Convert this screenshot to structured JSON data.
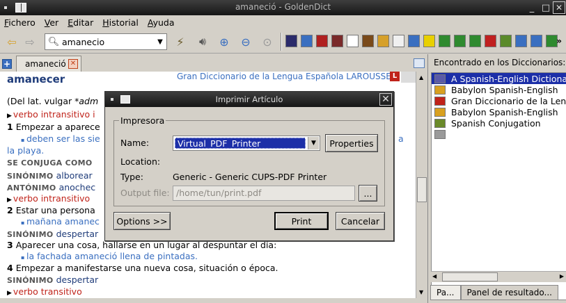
{
  "window": {
    "title": "amaneció - GoldenDict"
  },
  "menu": [
    "Fichero",
    "Ver",
    "Editar",
    "Historial",
    "Ayuda"
  ],
  "toolbar": {
    "search_value": "amanecio",
    "more": "»",
    "dict_icon_colors": [
      "#2b2b6b",
      "#3a6fc0",
      "#b02020",
      "#7a2a2a",
      "#fff",
      "#7a4a1a",
      "#d6a02a",
      "#f0f0f0",
      "#3a6fc0",
      "#e8d000",
      "#2f8a2f",
      "#2f8a2f",
      "#2f8a2f",
      "#c02020",
      "#5a8a2a",
      "#3a6fc0",
      "#3a6fc0",
      "#2f8a2f"
    ]
  },
  "tab": {
    "label": "amaneció"
  },
  "article": {
    "headword": "amanecer",
    "source": "Gran Diccionario de la Lengua Española LAROUSSE",
    "source_badge": "L",
    "lines": [
      {
        "t": "(Del lat. vulgar ",
        "i": "*adm"
      },
      {
        "red": "verbo intransitivo i"
      },
      {
        "num": "1",
        "t": "Empezar a aparece"
      },
      {
        "ex": "deben ser las sie",
        "ex2": "a"
      },
      {
        "blue": "la playa."
      },
      {
        "gray": "SE CONJUGA COMO"
      },
      {
        "gray": "SINÓNIMO",
        "navy": "alborear"
      },
      {
        "gray": "ANTÓNIMO",
        "navy": "anochec"
      },
      {
        "red": "verbo intransitivo"
      },
      {
        "num": "2",
        "t": "Estar una persona"
      },
      {
        "ex": "mañana amanec"
      },
      {
        "gray": "SINÓNIMO",
        "navy": "despertar"
      },
      {
        "num": "3",
        "t": "Aparecer una cosa, hallarse en un lugar al despuntar el día:"
      },
      {
        "ex": "la fachada amaneció llena de pintadas."
      },
      {
        "num": "4",
        "t": "Empezar a manifestarse una nueva cosa, situación o época."
      },
      {
        "gray": "SINÓNIMO",
        "navy": "despertar"
      },
      {
        "red": "verbo transitivo"
      }
    ]
  },
  "right": {
    "title": "Encontrado en los Diccionarios:",
    "items": [
      {
        "label": "A Spanish-English Dictionar",
        "color": "#5a5aa8"
      },
      {
        "label": "Babylon Spanish-English",
        "color": "#d8a020"
      },
      {
        "label": "Gran Diccionario de la Leng",
        "color": "#c0231a"
      },
      {
        "label": "Babylon Spanish-English",
        "color": "#d8a020"
      },
      {
        "label": "Spanish Conjugation",
        "color": "#6a8a2a"
      },
      {
        "label": "",
        "color": "#9a9a9a"
      }
    ],
    "tabs": [
      "Pa...",
      "Panel de resultado..."
    ]
  },
  "dialog": {
    "title": "Imprimir Artículo",
    "group": "Impresora",
    "name_label": "Name:",
    "name_value": "Virtual_PDF_Printer",
    "properties": "Properties",
    "location_label": "Location:",
    "location_value": "",
    "type_label": "Type:",
    "type_value": "Generic - Generic CUPS-PDF Printer",
    "output_label": "Output file:",
    "output_value": "/home/tun/print.pdf",
    "browse": "...",
    "options": "Options >>",
    "print": "Print",
    "cancel": "Cancelar"
  }
}
